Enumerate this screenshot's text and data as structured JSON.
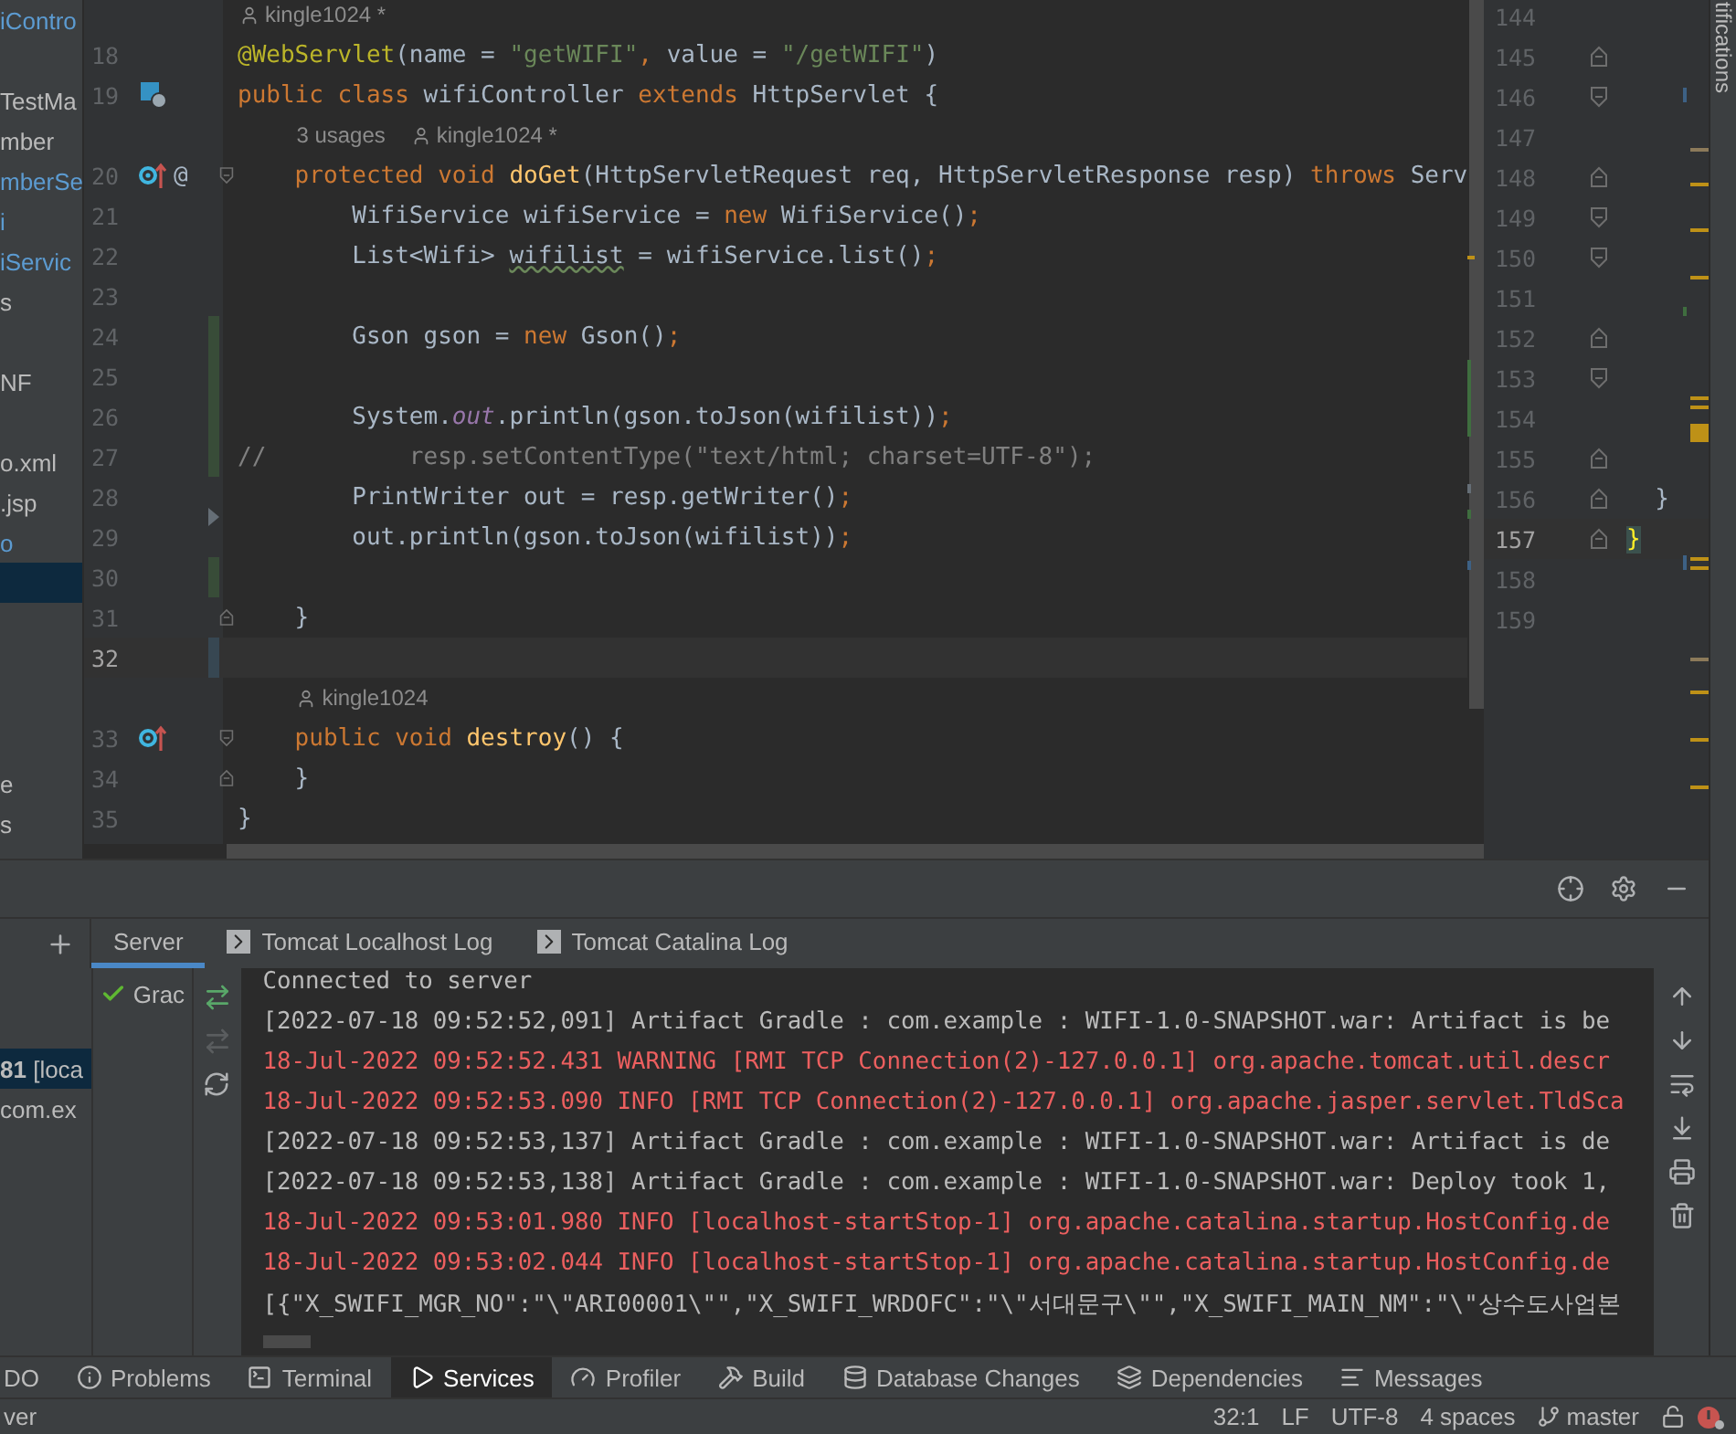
{
  "project_panel": {
    "items": [
      {
        "label": "iContro",
        "color": "#5c9bd1",
        "selected": false
      },
      {
        "selected": false
      },
      {
        "label": "TestMa",
        "color": "#bbbbbb",
        "selected": false
      },
      {
        "label": "mber",
        "color": "#bbbbbb",
        "selected": false
      },
      {
        "label": "mberSe",
        "color": "#5c9bd1",
        "selected": false
      },
      {
        "label": "i",
        "color": "#5c9bd1",
        "selected": false
      },
      {
        "label": "iServic",
        "color": "#5c9bd1",
        "selected": false
      },
      {
        "label": "s",
        "color": "#bbbbbb",
        "selected": false
      },
      {
        "selected": false
      },
      {
        "label": "NF",
        "color": "#bbbbbb",
        "selected": false
      },
      {
        "selected": false
      },
      {
        "label": "o.xml",
        "color": "#bbbbbb",
        "selected": false
      },
      {
        "label": ".jsp",
        "color": "#bbbbbb",
        "selected": false
      },
      {
        "label": "o",
        "color": "#5c9bd1",
        "selected": false
      },
      {
        "selected": true
      },
      {
        "selected": false
      },
      {
        "selected": false
      },
      {
        "selected": false
      },
      {
        "selected": false
      },
      {
        "label": "e",
        "color": "#bbbbbb",
        "selected": false
      },
      {
        "label": "s",
        "color": "#bbbbbb",
        "selected": false
      }
    ]
  },
  "editor": {
    "lines": [
      {
        "kind": "hint",
        "parts": [
          {
            "kind": "author",
            "text": "kingle1024 *"
          }
        ]
      },
      {
        "kind": "code",
        "number": "18",
        "current": false,
        "tokens": [
          {
            "kind": "ann",
            "text": "@WebServlet"
          },
          {
            "kind": "id",
            "text": "(name = "
          },
          {
            "kind": "str",
            "text": "\"getWIFI\""
          },
          {
            "kind": "kw",
            "text": ", "
          },
          {
            "kind": "id",
            "text": "value = "
          },
          {
            "kind": "str",
            "text": "\"/getWIFI\""
          },
          {
            "kind": "id",
            "text": ")"
          }
        ]
      },
      {
        "kind": "code",
        "number": "19",
        "current": false,
        "icons": [
          {
            "kind": "web"
          }
        ],
        "tokens": [
          {
            "kind": "kw",
            "text": "public class "
          },
          {
            "kind": "id",
            "text": "wifiController "
          },
          {
            "kind": "kw",
            "text": "extends "
          },
          {
            "kind": "id",
            "text": "HttpServlet {"
          }
        ]
      },
      {
        "kind": "hint",
        "parts": [
          {
            "kind": "usages",
            "text": "3 usages"
          },
          {
            "kind": "author",
            "text": "kingle1024 *"
          }
        ]
      },
      {
        "kind": "code",
        "number": "20",
        "current": false,
        "icons": [
          {
            "kind": "override"
          }
        ],
        "mark": "@",
        "fold": {
          "kind": "start"
        },
        "tokens": [
          {
            "kind": "kw",
            "text": "    protected void "
          },
          {
            "kind": "fn",
            "text": "doGet"
          },
          {
            "kind": "id",
            "text": "(HttpServletRequest req, HttpServletResponse resp) "
          },
          {
            "kind": "kw",
            "text": "throws "
          },
          {
            "kind": "id",
            "text": "Serv"
          }
        ]
      },
      {
        "kind": "code",
        "number": "21",
        "current": false,
        "tokens": [
          {
            "kind": "id",
            "text": "        WifiService wifiService = "
          },
          {
            "kind": "kw",
            "text": "new "
          },
          {
            "kind": "id",
            "text": "WifiService()"
          },
          {
            "kind": "kw",
            "text": ";"
          }
        ]
      },
      {
        "kind": "code",
        "number": "22",
        "current": false,
        "tokens": [
          {
            "kind": "id",
            "text": "        List<Wifi> "
          },
          {
            "kind": "warn",
            "text": "wifilist"
          },
          {
            "kind": "id",
            "text": " = wifiService.list()"
          },
          {
            "kind": "kw",
            "text": ";"
          }
        ]
      },
      {
        "kind": "code",
        "number": "23",
        "current": false
      },
      {
        "kind": "code",
        "number": "24",
        "current": false,
        "change": {
          "kind": "added"
        },
        "tokens": [
          {
            "kind": "id",
            "text": "        Gson gson = "
          },
          {
            "kind": "kw",
            "text": "new "
          },
          {
            "kind": "id",
            "text": "Gson()"
          },
          {
            "kind": "kw",
            "text": ";"
          }
        ]
      },
      {
        "kind": "code",
        "number": "25",
        "current": false,
        "change": {
          "kind": "added"
        }
      },
      {
        "kind": "code",
        "number": "26",
        "current": false,
        "change": {
          "kind": "added"
        },
        "tokens": [
          {
            "kind": "id",
            "text": "        System."
          },
          {
            "kind": "field",
            "text": "out"
          },
          {
            "kind": "id",
            "text": ".println(gson.toJson(wifilist))"
          },
          {
            "kind": "kw",
            "text": ";"
          }
        ]
      },
      {
        "kind": "code",
        "number": "27",
        "current": false,
        "change": {
          "kind": "added"
        },
        "tokens": [
          {
            "kind": "comment",
            "text": "//          resp.setContentType(\"text/html; charset=UTF-8\");"
          }
        ]
      },
      {
        "kind": "code",
        "number": "28",
        "current": false,
        "change": {
          "kind": "deleted"
        },
        "tokens": [
          {
            "kind": "id",
            "text": "        PrintWriter out = resp.getWriter()"
          },
          {
            "kind": "kw",
            "text": ";"
          }
        ]
      },
      {
        "kind": "code",
        "number": "29",
        "current": false,
        "tokens": [
          {
            "kind": "id",
            "text": "        out.println(gson.toJson(wifilist))"
          },
          {
            "kind": "kw",
            "text": ";"
          }
        ]
      },
      {
        "kind": "code",
        "number": "30",
        "current": false,
        "change": {
          "kind": "added"
        }
      },
      {
        "kind": "code",
        "number": "31",
        "current": false,
        "fold": {
          "kind": "end"
        },
        "tokens": [
          {
            "kind": "id",
            "text": "    }"
          }
        ]
      },
      {
        "kind": "code",
        "number": "32",
        "current": true,
        "change": {
          "kind": "modified"
        }
      },
      {
        "kind": "hint",
        "parts": [
          {
            "kind": "author",
            "text": "kingle1024"
          }
        ]
      },
      {
        "kind": "code",
        "number": "33",
        "current": false,
        "icons": [
          {
            "kind": "override"
          }
        ],
        "fold": {
          "kind": "start"
        },
        "tokens": [
          {
            "kind": "kw",
            "text": "    public void "
          },
          {
            "kind": "fn",
            "text": "destroy"
          },
          {
            "kind": "id",
            "text": "() {"
          }
        ]
      },
      {
        "kind": "code",
        "number": "34",
        "current": false,
        "fold": {
          "kind": "end"
        },
        "tokens": [
          {
            "kind": "id",
            "text": "    }"
          }
        ]
      },
      {
        "kind": "code",
        "number": "35",
        "current": false,
        "tokens": [
          {
            "kind": "id",
            "text": "}"
          }
        ]
      }
    ]
  },
  "split_editor": {
    "lines": [
      {
        "number": "144",
        "current": false
      },
      {
        "number": "145",
        "current": false,
        "fold": {
          "kind": "end"
        }
      },
      {
        "number": "146",
        "current": false,
        "fold": {
          "kind": "start"
        }
      },
      {
        "number": "147",
        "current": false
      },
      {
        "number": "148",
        "current": false,
        "fold": {
          "kind": "end"
        }
      },
      {
        "number": "149",
        "current": false,
        "fold": {
          "kind": "start"
        }
      },
      {
        "number": "150",
        "current": false,
        "fold": {
          "kind": "start"
        }
      },
      {
        "number": "151",
        "current": false
      },
      {
        "number": "152",
        "current": false,
        "fold": {
          "kind": "end"
        }
      },
      {
        "number": "153",
        "current": false,
        "fold": {
          "kind": "start"
        }
      },
      {
        "number": "154",
        "current": false
      },
      {
        "number": "155",
        "current": false,
        "fold": {
          "kind": "end"
        }
      },
      {
        "number": "156",
        "current": false,
        "fold": {
          "kind": "end"
        },
        "text": "  }"
      },
      {
        "number": "157",
        "current": true,
        "fold": {
          "kind": "end"
        },
        "text": "}"
      },
      {
        "number": "158",
        "current": false
      },
      {
        "number": "159",
        "current": false
      }
    ]
  },
  "notifications_strip": {
    "label": "tifications"
  },
  "services": {
    "tabs": [
      {
        "label": "Server",
        "selected": true
      },
      {
        "label": "Tomcat Localhost Log",
        "selected": false
      },
      {
        "label": "Tomcat Catalina Log",
        "selected": false
      }
    ],
    "tree": [
      {
        "label": "**81** [loca",
        "selected": true
      },
      {
        "label": "com.ex",
        "selected": false
      }
    ],
    "run_config": {
      "label": "Grac"
    },
    "console": {
      "lines": [
        {
          "kind": "system",
          "text": "Connected to server"
        },
        {
          "kind": "stdout",
          "text": "[2022-07-18 09:52:52,091] Artifact Gradle : com.example : WIFI-1.0-SNAPSHOT.war: Artifact is be"
        },
        {
          "kind": "stderr",
          "text": "18-Jul-2022 09:52:52.431 WARNING [RMI TCP Connection(2)-127.0.0.1] org.apache.tomcat.util.descr"
        },
        {
          "kind": "stderr",
          "text": "18-Jul-2022 09:52:53.090 INFO [RMI TCP Connection(2)-127.0.0.1] org.apache.jasper.servlet.TldSca"
        },
        {
          "kind": "stdout",
          "text": "[2022-07-18 09:52:53,137] Artifact Gradle : com.example : WIFI-1.0-SNAPSHOT.war: Artifact is de"
        },
        {
          "kind": "stdout",
          "text": "[2022-07-18 09:52:53,138] Artifact Gradle : com.example : WIFI-1.0-SNAPSHOT.war: Deploy took 1,"
        },
        {
          "kind": "stderr",
          "text": "18-Jul-2022 09:53:01.980 INFO [localhost-startStop-1] org.apache.catalina.startup.HostConfig.de"
        },
        {
          "kind": "stderr",
          "text": "18-Jul-2022 09:53:02.044 INFO [localhost-startStop-1] org.apache.catalina.startup.HostConfig.de"
        },
        {
          "kind": "stdout",
          "text": "[{\"X_SWIFI_MGR_NO\":\"\\\"ARI00001\\\"\",\"X_SWIFI_WRDOFC\":\"\\\"서대문구\\\"\",\"X_SWIFI_MAIN_NM\":\"\\\"상수도사업본"
        }
      ]
    }
  },
  "tool_tabs": [
    {
      "label": "DO",
      "selected": false
    },
    {
      "label": "Problems",
      "selected": false
    },
    {
      "label": "Terminal",
      "selected": false
    },
    {
      "label": "Services",
      "selected": true
    },
    {
      "label": "Profiler",
      "selected": false
    },
    {
      "label": "Build",
      "selected": false
    },
    {
      "label": "Database Changes",
      "selected": false
    },
    {
      "label": "Dependencies",
      "selected": false
    },
    {
      "label": "Messages",
      "selected": false
    }
  ],
  "status_bar": {
    "left": "ver",
    "items": [
      "32:1",
      "LF",
      "UTF-8",
      "4 spaces"
    ],
    "branch": "master"
  }
}
